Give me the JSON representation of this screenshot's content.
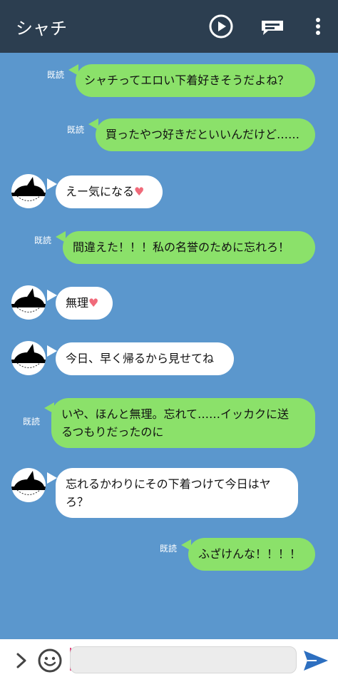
{
  "header": {
    "title": "シャチ",
    "bg": "#2c3e50"
  },
  "icons": {
    "play": "play-circle-icon",
    "notes": "note-icon",
    "menu": "more-vertical-icon"
  },
  "messages": [
    {
      "side": "out",
      "read": "既読",
      "lines": [
        "シャチってエロい下着好きそうだよね？"
      ]
    },
    {
      "side": "out",
      "read": "既読",
      "lines": [
        "買ったやつ好きだといいんだけど……"
      ]
    },
    {
      "side": "in",
      "lines": [
        "えー気になる"
      ],
      "heart": "♥"
    },
    {
      "side": "out",
      "read": "既読",
      "lines": [
        "間違えた！！！私の名誉のために忘れろ！"
      ]
    },
    {
      "side": "in",
      "lines": [
        "無理"
      ],
      "heart": "♥"
    },
    {
      "side": "in",
      "lines": [
        "今日、早く帰るから見せてね"
      ]
    },
    {
      "side": "out",
      "read": "既読",
      "lines": [
        "いや、ほんと無理。忘れて……イッカクに送",
        "るつもりだったのに"
      ]
    },
    {
      "side": "in",
      "lines": [
        "忘れるかわりにその下着つけて今日はヤ",
        "ろ？"
      ]
    },
    {
      "side": "out",
      "read": "既読",
      "lines": [
        "ふざけんな！！！！"
      ]
    }
  ],
  "colors": {
    "chat_bg": "#5b97cd",
    "out_bubble": "#8be16a",
    "in_bubble": "#ffffff",
    "heart": "#f06a7a",
    "send": "#2d6fc0"
  },
  "input": {
    "placeholder": ""
  }
}
